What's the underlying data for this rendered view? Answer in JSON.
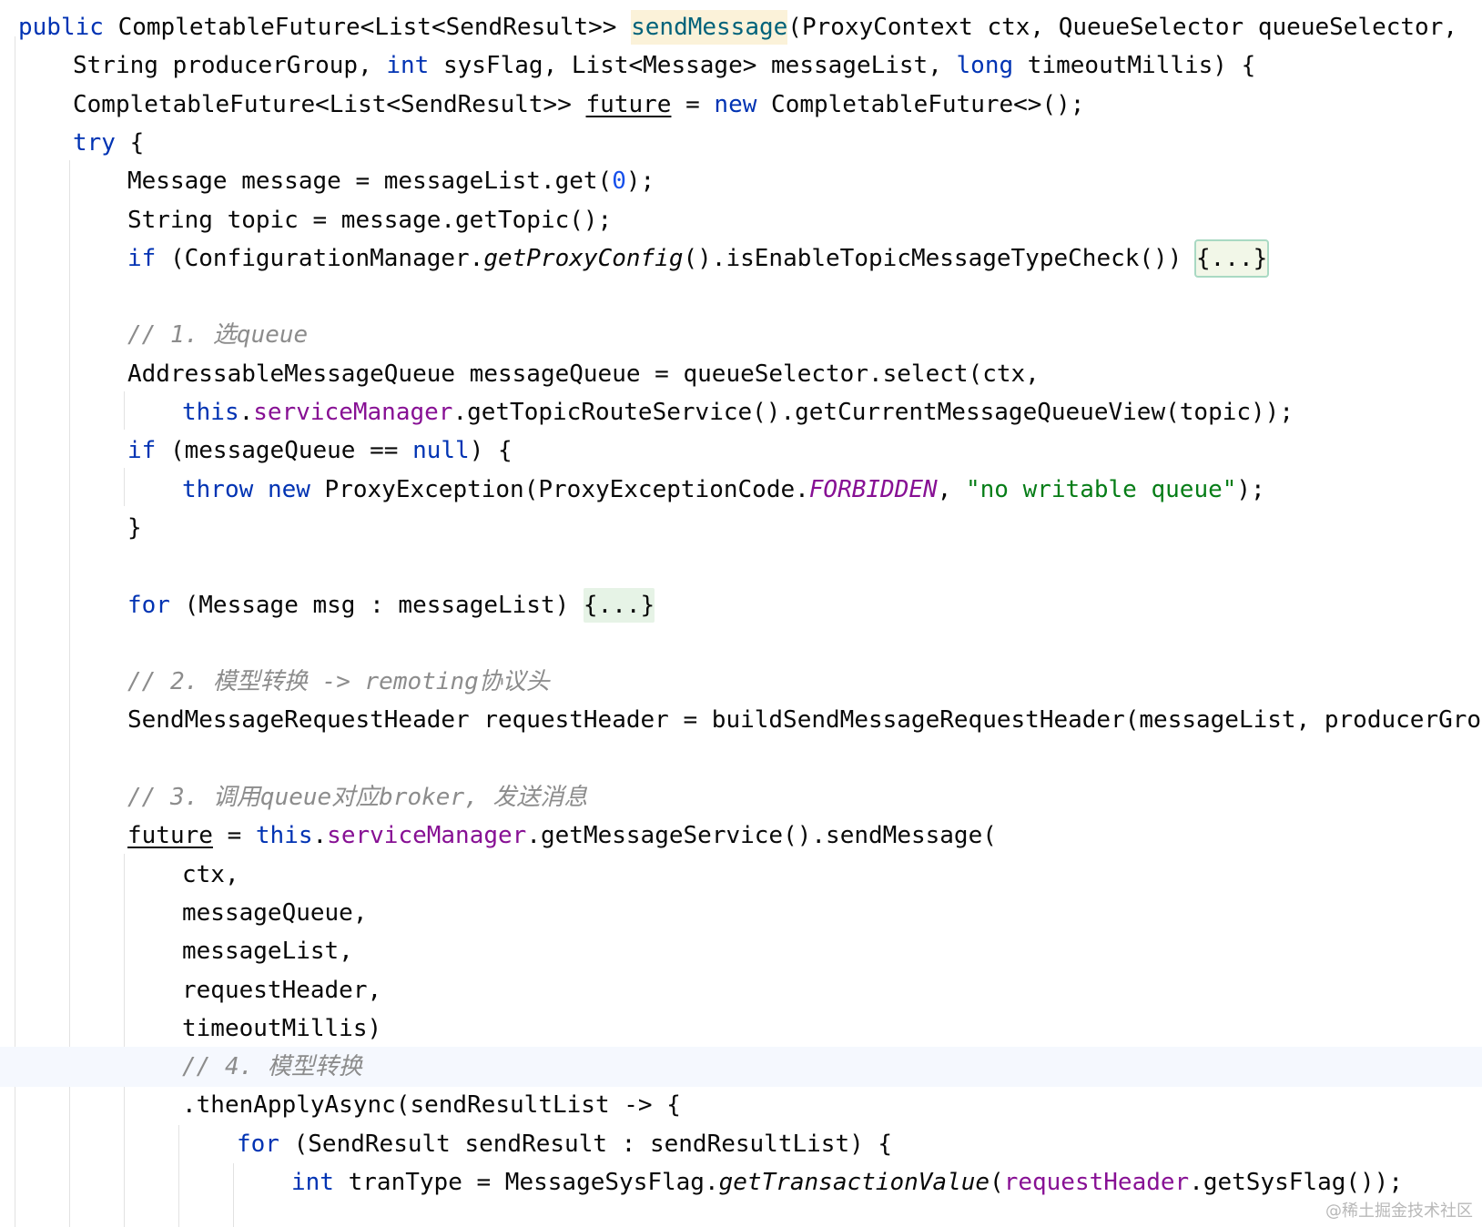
{
  "editor": {
    "colors": {
      "keyword": "#0033b3",
      "number": "#1750eb",
      "string": "#067d17",
      "field": "#871094",
      "comment": "#8c8c8c",
      "text": "#080808",
      "method_highlight": "#00627a",
      "current_line": "#f5f8fe",
      "fold_background": "#e6f3e6"
    },
    "lines": [
      {
        "indent": 0,
        "tokens": [
          {
            "t": "public",
            "c": "kw"
          },
          {
            "t": " CompletableFuture<List<SendResult>> "
          },
          {
            "t": "sendMessage",
            "c": "hl"
          },
          {
            "t": "(ProxyContext ctx, QueueSelector queueSelector,"
          }
        ]
      },
      {
        "indent": 1,
        "tokens": [
          {
            "t": "String producerGroup, "
          },
          {
            "t": "int",
            "c": "kw"
          },
          {
            "t": " sysFlag, List<Message> messageList, "
          },
          {
            "t": "long",
            "c": "kw"
          },
          {
            "t": " timeoutMillis) {"
          }
        ]
      },
      {
        "indent": 1,
        "tokens": [
          {
            "t": "CompletableFuture<List<SendResult>> "
          },
          {
            "t": "future",
            "c": "under"
          },
          {
            "t": " = "
          },
          {
            "t": "new",
            "c": "kw"
          },
          {
            "t": " CompletableFuture<>();"
          }
        ]
      },
      {
        "indent": 1,
        "tokens": [
          {
            "t": "try",
            "c": "kw"
          },
          {
            "t": " {"
          }
        ]
      },
      {
        "indent": 2,
        "tokens": [
          {
            "t": "Message message = messageList.get("
          },
          {
            "t": "0",
            "c": "num"
          },
          {
            "t": ");"
          }
        ]
      },
      {
        "indent": 2,
        "tokens": [
          {
            "t": "String topic = message.getTopic();"
          }
        ]
      },
      {
        "indent": 2,
        "tokens": [
          {
            "t": "if",
            "c": "kw"
          },
          {
            "t": " (ConfigurationManager."
          },
          {
            "t": "getProxyConfig",
            "c": "static"
          },
          {
            "t": "().isEnableTopicMessageTypeCheck()) "
          },
          {
            "t": "{...}",
            "c": "fold-sel"
          }
        ]
      },
      {
        "indent": 0,
        "tokens": []
      },
      {
        "indent": 2,
        "tokens": [
          {
            "t": "// 1. 选queue",
            "c": "comment"
          }
        ]
      },
      {
        "indent": 2,
        "tokens": [
          {
            "t": "AddressableMessageQueue messageQueue = queueSelector.select(ctx,"
          }
        ]
      },
      {
        "indent": 3,
        "tokens": [
          {
            "t": "this",
            "c": "kw"
          },
          {
            "t": "."
          },
          {
            "t": "serviceManager",
            "c": "field"
          },
          {
            "t": ".getTopicRouteService().getCurrentMessageQueueView(topic));"
          }
        ]
      },
      {
        "indent": 2,
        "tokens": [
          {
            "t": "if",
            "c": "kw"
          },
          {
            "t": " (messageQueue == "
          },
          {
            "t": "null",
            "c": "kw"
          },
          {
            "t": ") {"
          }
        ]
      },
      {
        "indent": 3,
        "tokens": [
          {
            "t": "throw",
            "c": "kw"
          },
          {
            "t": " "
          },
          {
            "t": "new",
            "c": "kw"
          },
          {
            "t": " ProxyException(ProxyExceptionCode."
          },
          {
            "t": "FORBIDDEN",
            "c": "const"
          },
          {
            "t": ", "
          },
          {
            "t": "\"no writable queue\"",
            "c": "str"
          },
          {
            "t": ");"
          }
        ]
      },
      {
        "indent": 2,
        "tokens": [
          {
            "t": "}"
          }
        ]
      },
      {
        "indent": 0,
        "tokens": []
      },
      {
        "indent": 2,
        "tokens": [
          {
            "t": "for",
            "c": "kw"
          },
          {
            "t": " (Message msg : messageList) "
          },
          {
            "t": "{...}",
            "c": "fold"
          }
        ]
      },
      {
        "indent": 0,
        "tokens": []
      },
      {
        "indent": 2,
        "tokens": [
          {
            "t": "// 2. 模型转换 -> remoting协议头",
            "c": "comment"
          }
        ]
      },
      {
        "indent": 2,
        "tokens": [
          {
            "t": "SendMessageRequestHeader requestHeader = buildSendMessageRequestHeader(messageList, producerGro"
          }
        ]
      },
      {
        "indent": 0,
        "tokens": []
      },
      {
        "indent": 2,
        "tokens": [
          {
            "t": "// 3. 调用queue对应broker, 发送消息",
            "c": "comment"
          }
        ]
      },
      {
        "indent": 2,
        "tokens": [
          {
            "t": "future",
            "c": "under"
          },
          {
            "t": " = "
          },
          {
            "t": "this",
            "c": "kw"
          },
          {
            "t": "."
          },
          {
            "t": "serviceManager",
            "c": "field"
          },
          {
            "t": ".getMessageService().sendMessage("
          }
        ]
      },
      {
        "indent": 3,
        "tokens": [
          {
            "t": "ctx,"
          }
        ]
      },
      {
        "indent": 3,
        "tokens": [
          {
            "t": "messageQueue,"
          }
        ]
      },
      {
        "indent": 3,
        "tokens": [
          {
            "t": "messageList,"
          }
        ]
      },
      {
        "indent": 3,
        "tokens": [
          {
            "t": "requestHeader,"
          }
        ]
      },
      {
        "indent": 3,
        "tokens": [
          {
            "t": "timeoutMillis)"
          }
        ]
      },
      {
        "indent": 3,
        "current": true,
        "tokens": [
          {
            "t": "// 4. 模型转换",
            "c": "comment"
          }
        ]
      },
      {
        "indent": 3,
        "tokens": [
          {
            "t": ".thenApplyAsync(sendResultList -> {"
          }
        ]
      },
      {
        "indent": 4,
        "tokens": [
          {
            "t": "for",
            "c": "kw"
          },
          {
            "t": " (SendResult sendResult : sendResultList) {"
          }
        ]
      },
      {
        "indent": 5,
        "tokens": [
          {
            "t": "int",
            "c": "kw"
          },
          {
            "t": " tranType = MessageSysFlag."
          },
          {
            "t": "getTransactionValue",
            "c": "static"
          },
          {
            "t": "("
          },
          {
            "t": "requestHeader",
            "c": "field"
          },
          {
            "t": ".getSysFlag());"
          }
        ]
      }
    ]
  },
  "watermark": "@稀土掘金技术社区"
}
